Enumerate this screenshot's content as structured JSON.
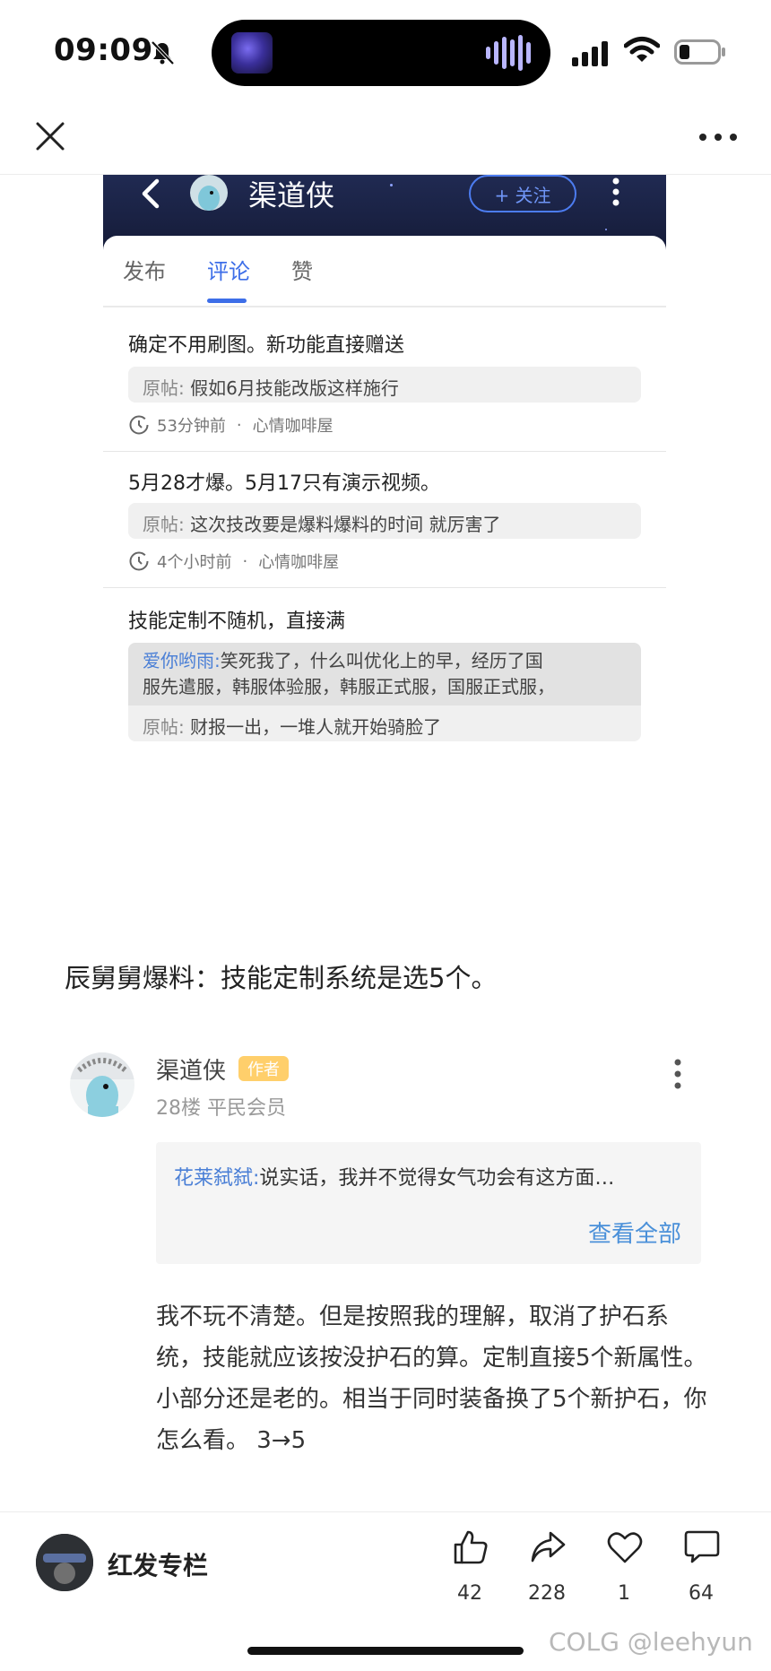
{
  "status_bar": {
    "time": "09:09"
  },
  "embed": {
    "username": "渠道侠",
    "follow_label": "+ 关注",
    "tabs": [
      {
        "label": "发布"
      },
      {
        "label": "评论"
      },
      {
        "label": "赞"
      }
    ],
    "comments": [
      {
        "text": "确定不用刷图。新功能直接赠送",
        "quote_label": "原帖:",
        "quote": "假如6月技能改版这样施行",
        "time": "53分钟前",
        "board": "心情咖啡屋"
      },
      {
        "text": "5月28才爆。5月17只有演示视频。",
        "quote_label": "原帖:",
        "quote": "这次技改要是爆料爆料的时间 就厉害了",
        "time": "4个小时前",
        "board": "心情咖啡屋"
      },
      {
        "text": "技能定制不随机，直接满",
        "reply_name": "爱你哟雨:",
        "reply_line1": "笑死我了，什么叫优化上的早，经历了国",
        "reply_line2": "服先遣服，韩服体验服，韩服正式服，国服正式服，",
        "quote_label": "原帖:",
        "quote": "财报一出，一堆人就开始骑脸了"
      }
    ],
    "meta_dot": "·"
  },
  "headline": "辰舅舅爆料：技能定制系统是选5个。",
  "comment_block": {
    "author": "渠道侠",
    "badge": "作者",
    "floor": "28楼 平民会员",
    "reply_name": "花莱弑弑:",
    "reply_text": "说实话，我并不觉得女气功会有这方面…",
    "view_all": "查看全部",
    "body": "我不玩不清楚。但是按照我的理解，取消了护石系统，技能就应该按没护石的算。定制直接5个新属性。小部分还是老的。相当于同时装备换了5个新护石，你怎么看。 3→5"
  },
  "bottom_bar": {
    "column_name": "红发专栏",
    "likes": "42",
    "shares": "228",
    "favorites": "1",
    "comments": "64",
    "watermark": "COLG @leehyun"
  },
  "colors": {
    "accent": "#3d6ee8",
    "badge": "#ffcf6b",
    "link": "#4a90d9"
  }
}
